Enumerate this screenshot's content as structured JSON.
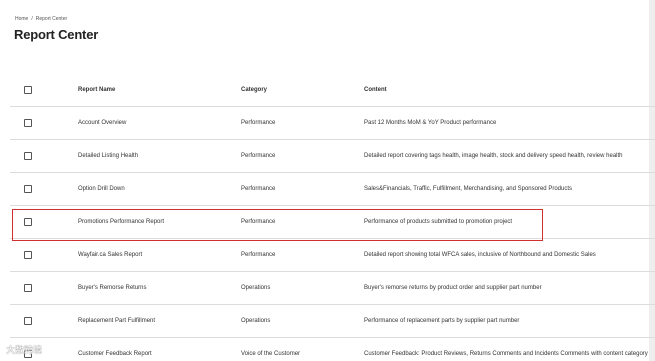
{
  "breadcrumb": {
    "home": "Home",
    "separator": "/",
    "current": "Report Center"
  },
  "page_title": "Report Center",
  "table": {
    "headers": {
      "name": "Report Name",
      "category": "Category",
      "content": "Content"
    },
    "rows": [
      {
        "name": "Account Overview",
        "category": "Performance",
        "content": "Past 12 Months MoM & YoY Product performance"
      },
      {
        "name": "Detailed Listing Health",
        "category": "Performance",
        "content": "Detailed report covering tags health, image health, stock and delivery speed health, review health"
      },
      {
        "name": "Option Drill Down",
        "category": "Performance",
        "content": "Sales&Financials, Traffic, Fulfillment, Merchandising, and Sponsored Products"
      },
      {
        "name": "Promotions Performance Report",
        "category": "Performance",
        "content": "Performance of products submitted to promotion project"
      },
      {
        "name": "Wayfair.ca Sales Report",
        "category": "Performance",
        "content": "Detailed report showing total WFCA sales, inclusive of Northbound and Domestic Sales"
      },
      {
        "name": "Buyer's Remorse Returns",
        "category": "Operations",
        "content": "Buyer's remorse returns by product order and supplier part number"
      },
      {
        "name": "Replacement Part Fulfillment",
        "category": "Operations",
        "content": "Performance of replacement parts by supplier part number"
      },
      {
        "name": "Customer Feedback Report",
        "category": "Voice of the Customer",
        "content": "Customer Feedback: Product Reviews, Returns Comments and Incidents Comments with content category"
      }
    ]
  },
  "highlight_color": "#d22f2f",
  "watermark_text": "大数跨境"
}
